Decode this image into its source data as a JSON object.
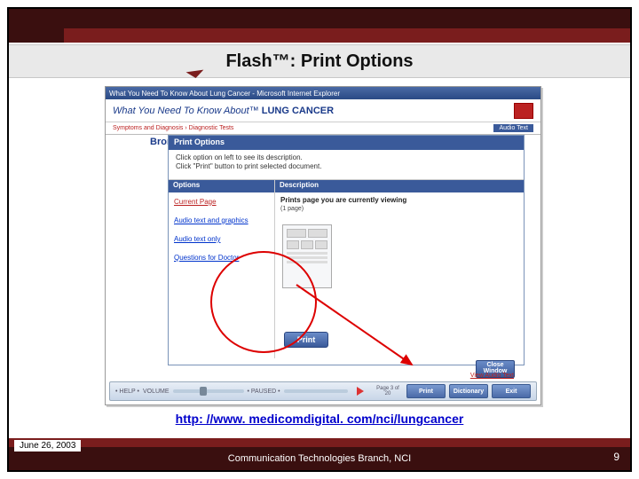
{
  "slide": {
    "title": "Flash™: Print Options",
    "link_text": "http: //www. medicomdigital. com/nci/lungcancer"
  },
  "footer": {
    "date": "June 26, 2003",
    "branch": "Communication Technologies Branch, NCI",
    "page_number": "9"
  },
  "screenshot": {
    "window_title": "What You Need To Know About Lung Cancer - Microsoft Internet Explorer",
    "header_prefix": "What You Need To Know About™",
    "header_strong": "LUNG CANCER",
    "breadcrumb_left": "Symptoms and Diagnosis › Diagnostic Tests",
    "breadcrumb_right": "Audio Text",
    "truncated_label": "Bronc",
    "below_link": "View Audio Text",
    "modal": {
      "title": "Print Options",
      "instructions_l1": "Click option on left to see its description.",
      "instructions_l2": "Click \"Print\" button to print selected document.",
      "col_options": "Options",
      "col_description": "Description",
      "options": [
        "Current Page",
        "Audio text and graphics",
        "Audio text only",
        "Questions for Doctor"
      ],
      "desc_text": "Prints page you are currently viewing",
      "page_count": "(1 page)",
      "print_btn": "Print",
      "close_btn_l1": "Close",
      "close_btn_l2": "Window"
    },
    "toolbar": {
      "help": "• HELP •",
      "volume": "VOLUME",
      "paused": "• PAUSED •",
      "page_indicator": "Page 3 of 20",
      "btn_print": "Print",
      "btn_dict": "Dictionary",
      "btn_exit": "Exit"
    }
  }
}
